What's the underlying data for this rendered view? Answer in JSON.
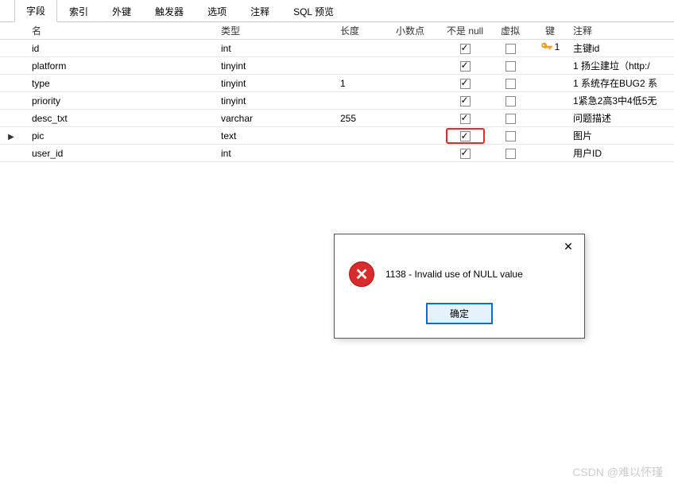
{
  "tabs": {
    "items": [
      {
        "label": "字段",
        "active": true
      },
      {
        "label": "索引",
        "active": false
      },
      {
        "label": "外键",
        "active": false
      },
      {
        "label": "触发器",
        "active": false
      },
      {
        "label": "选项",
        "active": false
      },
      {
        "label": "注释",
        "active": false
      },
      {
        "label": "SQL 预览",
        "active": false
      }
    ]
  },
  "grid": {
    "headers": {
      "name": "名",
      "type": "类型",
      "length": "长度",
      "decimal": "小数点",
      "not_null": "不是 null",
      "virtual": "虚拟",
      "key": "键",
      "comment": "注释"
    },
    "rows": [
      {
        "name": "id",
        "type": "int",
        "length": "",
        "decimal": "",
        "not_null": true,
        "virtual": false,
        "key": "1",
        "comment": "主键id",
        "selected": false,
        "highlight": false
      },
      {
        "name": "platform",
        "type": "tinyint",
        "length": "",
        "decimal": "",
        "not_null": true,
        "virtual": false,
        "key": "",
        "comment": "1 扬尘建垃（http:/",
        "selected": false,
        "highlight": false
      },
      {
        "name": "type",
        "type": "tinyint",
        "length": "1",
        "decimal": "",
        "not_null": true,
        "virtual": false,
        "key": "",
        "comment": "1 系统存在BUG2 系",
        "selected": false,
        "highlight": false
      },
      {
        "name": "priority",
        "type": "tinyint",
        "length": "",
        "decimal": "",
        "not_null": true,
        "virtual": false,
        "key": "",
        "comment": "1紧急2高3中4低5无",
        "selected": false,
        "highlight": false
      },
      {
        "name": "desc_txt",
        "type": "varchar",
        "length": "255",
        "decimal": "",
        "not_null": true,
        "virtual": false,
        "key": "",
        "comment": "问题描述",
        "selected": false,
        "highlight": false
      },
      {
        "name": "pic",
        "type": "text",
        "length": "",
        "decimal": "",
        "not_null": true,
        "virtual": false,
        "key": "",
        "comment": "图片",
        "selected": true,
        "highlight": true
      },
      {
        "name": "user_id",
        "type": "int",
        "length": "",
        "decimal": "",
        "not_null": true,
        "virtual": false,
        "key": "",
        "comment": "用户ID",
        "selected": false,
        "highlight": false
      }
    ]
  },
  "dialog": {
    "message": "1138 - Invalid use of NULL value",
    "ok_label": "确定",
    "close_label": "✕"
  },
  "watermark": "CSDN @难以怀瑾"
}
